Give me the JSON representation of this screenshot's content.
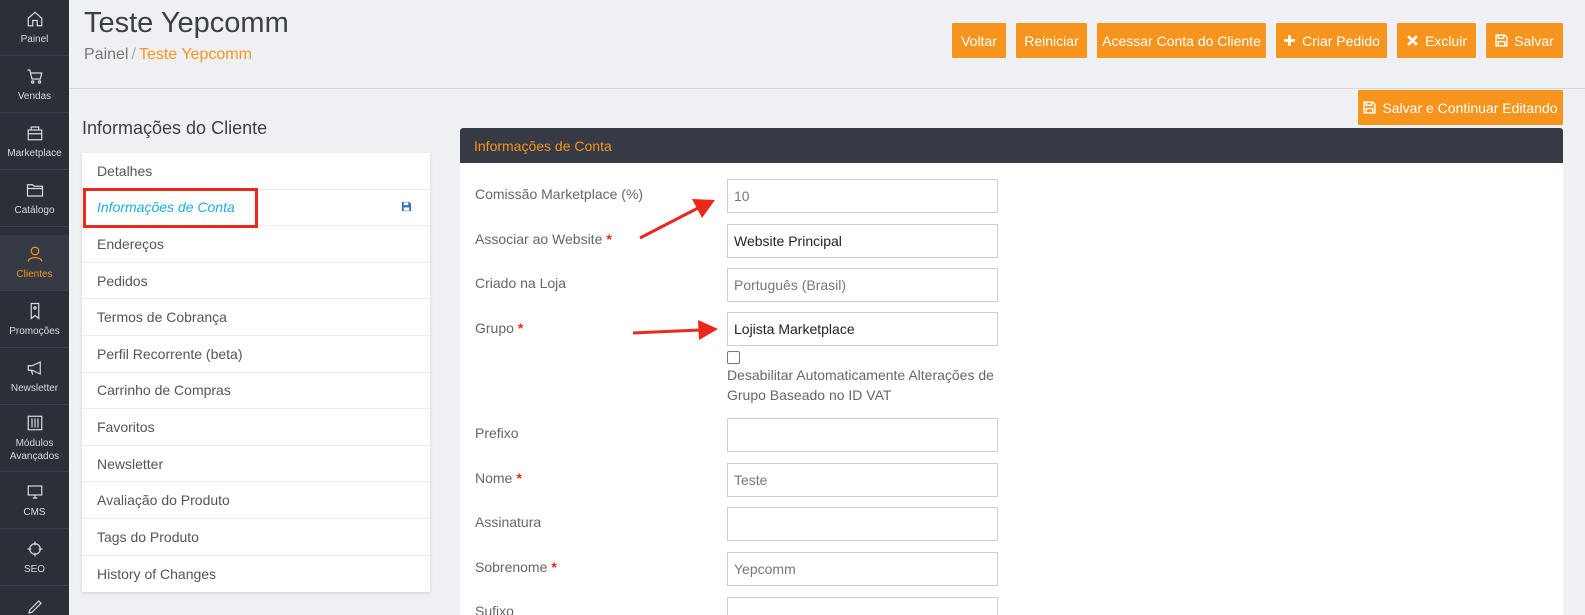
{
  "sidebar": {
    "items": [
      {
        "label": "Painel",
        "icon": "home-icon"
      },
      {
        "label": "Vendas",
        "icon": "cart-icon"
      },
      {
        "label": "Marketplace",
        "icon": "store-icon"
      },
      {
        "label": "Catálogo",
        "icon": "folder-icon"
      },
      {
        "label": "Clientes",
        "icon": "user-icon",
        "active": true
      },
      {
        "label": "Promoções",
        "icon": "tag-icon"
      },
      {
        "label": "Newsletter",
        "icon": "megaphone-icon"
      },
      {
        "label": "Módulos Avançados",
        "icon": "sliders-icon"
      },
      {
        "label": "CMS",
        "icon": "monitor-icon"
      },
      {
        "label": "SEO",
        "icon": "crosshair-icon"
      }
    ]
  },
  "header": {
    "title": "Teste Yepcomm",
    "breadcrumb": {
      "root": "Painel",
      "sep": "/",
      "current": "Teste Yepcomm"
    },
    "buttons": {
      "voltar": "Voltar",
      "reiniciar": "Reiniciar",
      "acessar": "Acessar Conta do Cliente",
      "criar_pedido": "Criar Pedido",
      "excluir": "Excluir",
      "salvar": "Salvar",
      "salvar_continuar": "Salvar e Continuar Editando"
    }
  },
  "tabs_title": "Informações do Cliente",
  "tabs": [
    "Detalhes",
    "Informações de Conta",
    "Endereços",
    "Pedidos",
    "Termos de Cobrança",
    "Perfil Recorrente (beta)",
    "Carrinho de Compras",
    "Favoritos",
    "Newsletter",
    "Avaliação do Produto",
    "Tags do Produto",
    "History of Changes"
  ],
  "panel": {
    "title": "Informações de Conta",
    "fields": {
      "comissao": {
        "label": "Comissão Marketplace (%)",
        "value": "10"
      },
      "website": {
        "label": "Associar ao Website",
        "value": "Website Principal"
      },
      "loja": {
        "label": "Criado na Loja",
        "value": "Português (Brasil)"
      },
      "grupo": {
        "label": "Grupo",
        "value": "Lojista Marketplace"
      },
      "vat_checkbox": "Desabilitar Automaticamente Alterações de Grupo Baseado no ID VAT",
      "prefixo": {
        "label": "Prefixo",
        "value": ""
      },
      "nome": {
        "label": "Nome",
        "value": "Teste"
      },
      "assinatura": {
        "label": "Assinatura",
        "value": ""
      },
      "sobrenome": {
        "label": "Sobrenome",
        "value": "Yepcomm"
      },
      "sufixo_partial": {
        "label": "Sufixo"
      }
    },
    "required_mark": "*"
  },
  "colors": {
    "accent": "#f7941d",
    "sidebar_bg": "#2b2f38",
    "panel_header_bg": "#353a44",
    "annotation_red": "#e8291c",
    "active_tab": "#1eaedb"
  }
}
